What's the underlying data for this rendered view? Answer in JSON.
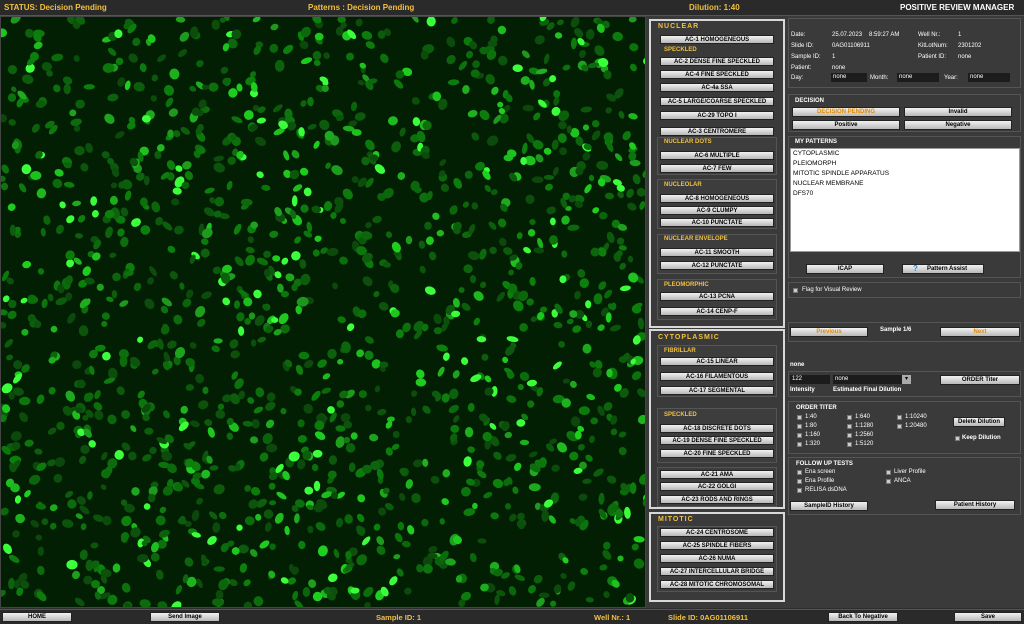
{
  "header": {
    "status": "STATUS: Decision Pending",
    "patterns": "Patterns : Decision Pending",
    "dilution": "Dilution: 1:40",
    "title": "POSITIVE REVIEW MANAGER"
  },
  "patterns": {
    "nuclear": {
      "title": "NUCLEAR",
      "homogeneous": "AC-1 HOMOGENEOUS",
      "speckled_title": "SPECKLED",
      "speckled": [
        "AC-2 DENSE FINE SPECKLED",
        "AC-4 FINE SPECKLED",
        "AC-4a SSA",
        "AC-5 LARGE/COARSE SPECKLED",
        "AC-29 TOPO I"
      ],
      "centromere": "AC-3 CENTROMERE",
      "dots_title": "NUCLEAR DOTS",
      "dots": [
        "AC-6 MULTIPLE",
        "AC-7 FEW"
      ],
      "nucleolar_title": "NUCLEOLAR",
      "nucleolar": [
        "AC-8 HOMOGENEOUS",
        "AC-9 CLUMPY",
        "AC-10 PUNCTATE"
      ],
      "envelope_title": "NUCLEAR ENVELOPE",
      "envelope": [
        "AC-11 SMOOTH",
        "AC-12 PUNCTATE"
      ],
      "pleomorphic_title": "PLEOMORPHIC",
      "pleomorphic": [
        "AC-13 PCNA",
        "AC-14 CENP-F"
      ]
    },
    "cytoplasmic": {
      "title": "CYTOPLASMIC",
      "fibrillar_title": "FIBRILLAR",
      "fibrillar": [
        "AC-15 LINEAR",
        "AC-16 FILAMENTOUS",
        "AC-17 SEGMENTAL"
      ],
      "speckled_title": "SPECKLED",
      "speckled": [
        "AC-18 DISCRETE DOTS",
        "AC-19 DENSE FINE SPECKLED",
        "AC-20 FINE SPECKLED"
      ],
      "others": [
        "AC-21 AMA",
        "AC-22 GOLGI",
        "AC-23 RODS AND RINGS"
      ]
    },
    "mitotic": {
      "title": "MITOTIC",
      "items": [
        "AC-24 CENTROSOME",
        "AC-25 SPINDLE FIBERS",
        "AC-26 NUMA",
        "AC-27 INTERCELLULAR BRIDGE",
        "AC-28 MITOTIC CHROMOSOMAL"
      ]
    }
  },
  "info": {
    "date_label": "Date:",
    "date": "25.07.2023",
    "time": "8:59:27 AM",
    "well_label": "Well Nr.:",
    "well": "1",
    "slide_label": "Slide ID:",
    "slide": "0AG01106911",
    "kit_label": "KitLotNum:",
    "kit": "2301202",
    "sample_label": "Sample ID:",
    "sample": "1",
    "patient_id_label": "Patient ID:",
    "patient_id": "none",
    "patient_label": "Patient:",
    "patient": "none",
    "day_label": "Day:",
    "day": "none",
    "month_label": "Month:",
    "month": "none",
    "year_label": "Year:",
    "year": "none"
  },
  "decision": {
    "title": "DECISION",
    "pending": "DECISION PENDING",
    "invalid": "Invalid",
    "positive": "Positive",
    "negative": "Negative"
  },
  "my_patterns": {
    "title": "MY PATTERNS",
    "items": [
      "CYTOPLASMIC",
      "PLEIOMORPH",
      "MITOTIC SPINDLE APPARATUS",
      "NUCLEAR MEMBRANE",
      "DFS70"
    ],
    "icap": "ICAP",
    "assist": "Pattern Assist"
  },
  "flag": {
    "label": "Flag for Visual Review"
  },
  "nav": {
    "previous": "Previous",
    "sample": "Sample 1/6",
    "next": "Next"
  },
  "intensity": {
    "none_text": "none",
    "value": "122",
    "label": "Intensity",
    "dilution_value": "none",
    "dilution_label": "Estimated Final Dilution",
    "order_titer_btn": "ORDER Titer"
  },
  "order_titer": {
    "title": "ORDER TITER",
    "options": [
      "1:40",
      "1:80",
      "1:160",
      "1:320",
      "1:640",
      "1:1280",
      "1:2560",
      "1:5120",
      "1:10240",
      "1:20480"
    ],
    "delete": "Delete Dilution",
    "keep": "Keep Dilution"
  },
  "follow_up": {
    "title": "FOLLOW UP TESTS",
    "left": [
      "Ena screen",
      "Ena Profile",
      "RELISA dsDNA"
    ],
    "right": [
      "Liver Profile",
      "ANCA"
    ],
    "sample_history": "SampleID History",
    "patient_history": "Patient History"
  },
  "footer": {
    "home": "HOME",
    "send_image": "Send Image",
    "sample_id": "Sample ID: 1",
    "well": "Well Nr.: 1",
    "slide": "Slide ID: 0AG01106911",
    "back": "Back To Negative",
    "save": "Save"
  },
  "colors": {
    "accent": "#f0c040",
    "cell": "#2eff2e",
    "background": "#2e2e2e"
  }
}
